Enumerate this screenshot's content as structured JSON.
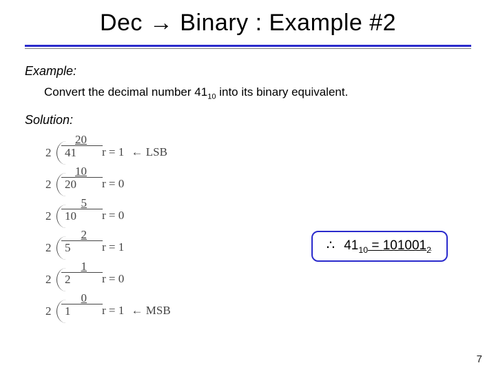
{
  "title": "Dec → Binary : Example #2",
  "labels": {
    "example": "Example:",
    "solution": "Solution:"
  },
  "problem": {
    "prefix": "Convert the decimal number 41",
    "sub1": "10",
    "suffix": " into its binary equivalent."
  },
  "steps": [
    {
      "divisor": "2",
      "dividend": "41",
      "quotient": "20",
      "rem": "r = 1",
      "note": "← LSB"
    },
    {
      "divisor": "2",
      "dividend": "20",
      "quotient": "10",
      "rem": "r = 0",
      "note": ""
    },
    {
      "divisor": "2",
      "dividend": "10",
      "quotient": "5",
      "rem": "r = 0",
      "note": ""
    },
    {
      "divisor": "2",
      "dividend": "5",
      "quotient": "2",
      "rem": "r = 1",
      "note": ""
    },
    {
      "divisor": "2",
      "dividend": "2",
      "quotient": "1",
      "rem": "r = 0",
      "note": ""
    },
    {
      "divisor": "2",
      "dividend": "1",
      "quotient": "0",
      "rem": "r = 1",
      "note": "← MSB"
    }
  ],
  "result": {
    "therefore": "∴",
    "lhs_num": "41",
    "lhs_sub": "10",
    "eq": " = ",
    "rhs_num": "101001",
    "rhs_sub": "2"
  },
  "page": "7"
}
